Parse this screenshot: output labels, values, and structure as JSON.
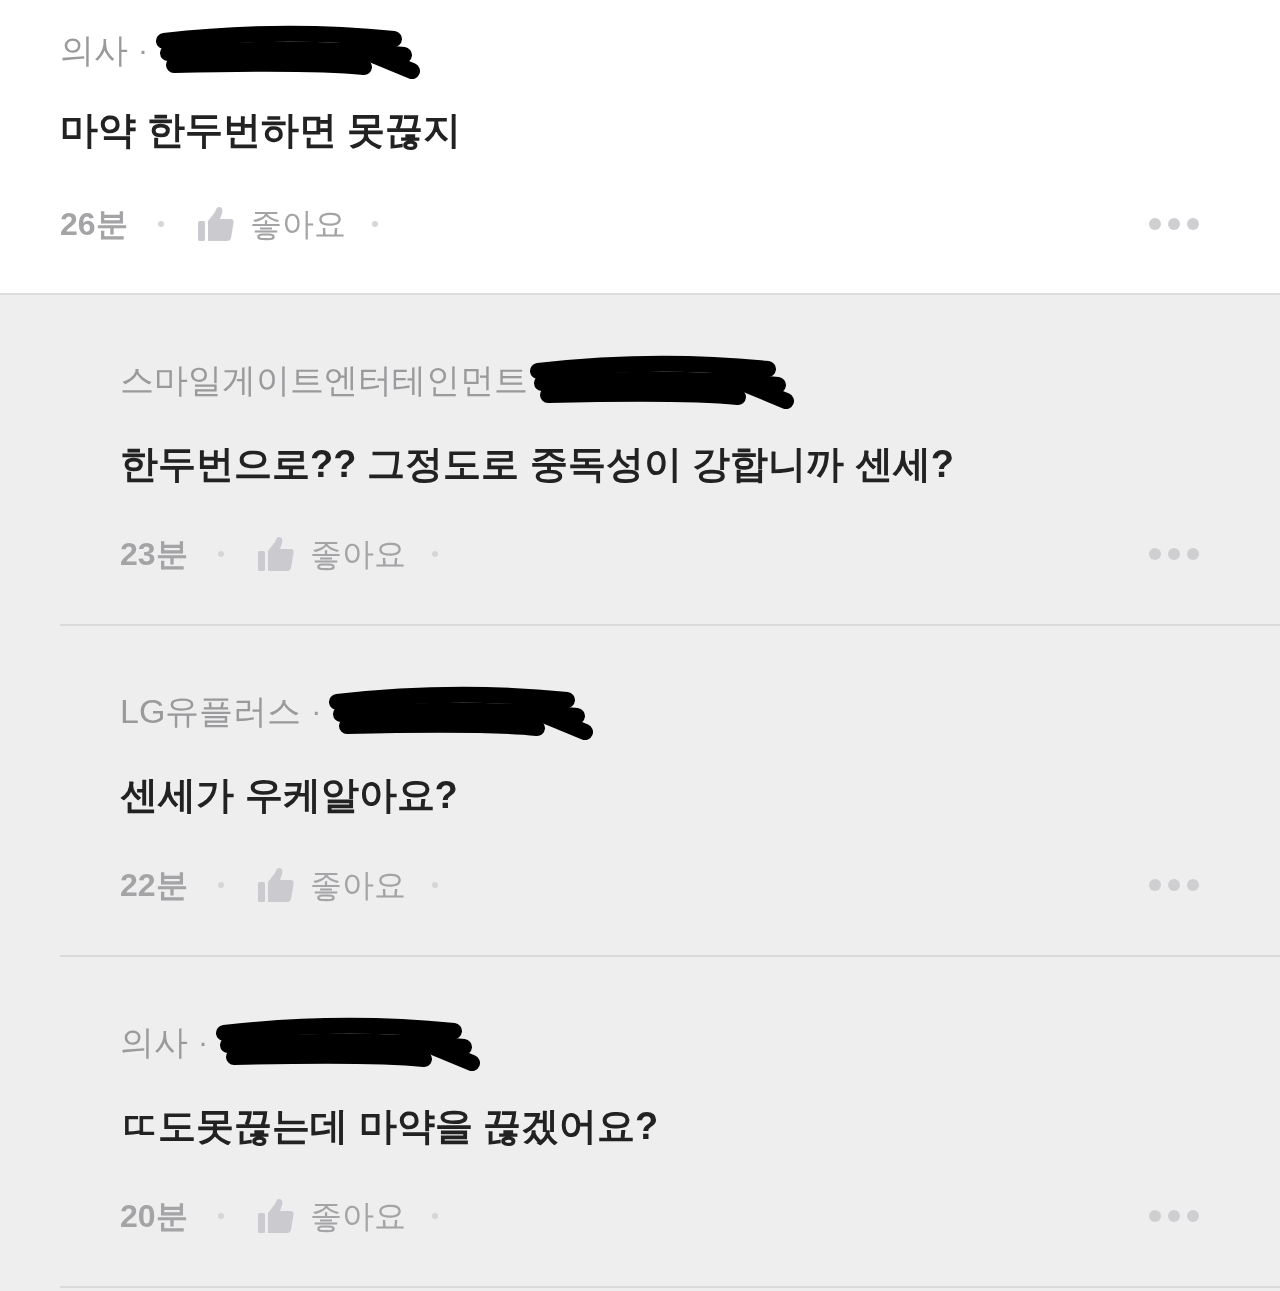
{
  "comments": [
    {
      "kind": "comment",
      "author": "의사",
      "separator": "·",
      "name_redacted": true,
      "text": "마약 한두번하면 못끊지",
      "time": "26분",
      "like_label": "좋아요"
    },
    {
      "kind": "reply",
      "author": "스마일게이트엔터테인먼트",
      "name_redacted": true,
      "text": "한두번으로?? 그정도로 중독성이 강합니까 센세?",
      "time": "23분",
      "like_label": "좋아요"
    },
    {
      "kind": "reply",
      "author": "LG유플러스",
      "separator": "·",
      "name_redacted": true,
      "text": "센세가 우케알아요?",
      "time": "22분",
      "like_label": "좋아요"
    },
    {
      "kind": "reply",
      "author": "의사",
      "separator": "·",
      "name_redacted": true,
      "text": "ㄸ도못끊는데 마약을 끊겠어요?",
      "time": "20분",
      "like_label": "좋아요"
    }
  ]
}
